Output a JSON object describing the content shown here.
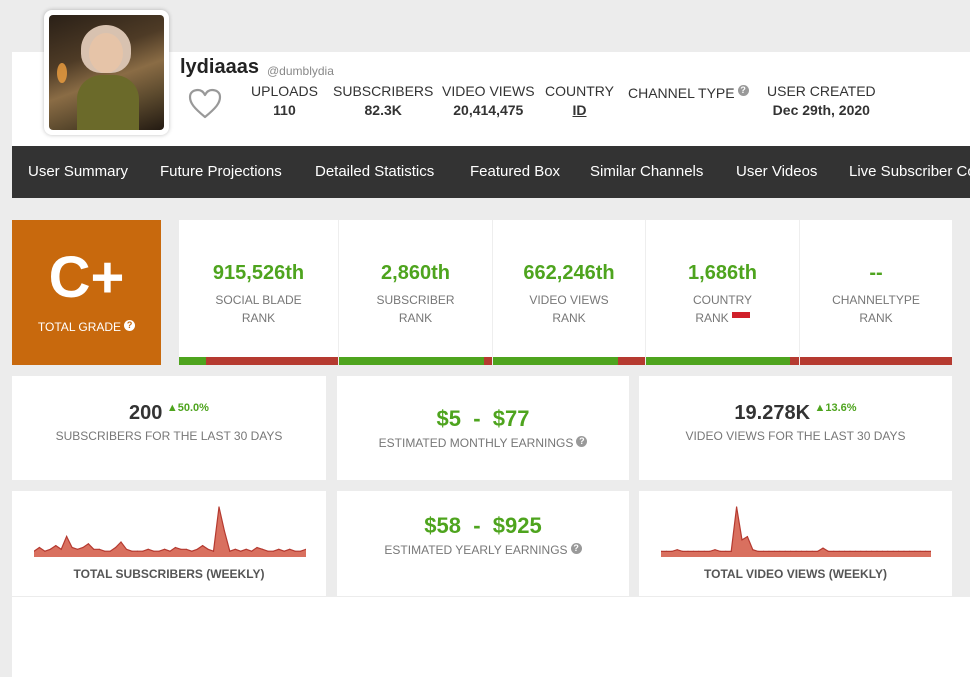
{
  "channel": {
    "name": "lydiaaas",
    "handle": "@dumblydia",
    "avatar_icon": "profile-photo"
  },
  "header_stats": [
    {
      "label": "UPLOADS",
      "value": "110"
    },
    {
      "label": "SUBSCRIBERS",
      "value": "82.3K"
    },
    {
      "label": "VIDEO VIEWS",
      "value": "20,414,475"
    },
    {
      "label": "COUNTRY",
      "value": "ID"
    },
    {
      "label": "CHANNEL TYPE",
      "value": ""
    },
    {
      "label": "USER CREATED",
      "value": "Dec 29th, 2020"
    }
  ],
  "nav": [
    "User Summary",
    "Future Projections",
    "Detailed Statistics",
    "Featured Box",
    "Similar Channels",
    "User Videos",
    "Live Subscriber Co"
  ],
  "grade": {
    "value": "C+",
    "label": "TOTAL GRADE"
  },
  "ranks": [
    {
      "value": "915,526th",
      "line1": "SOCIAL BLADE",
      "line2": "RANK",
      "fill": 0.17
    },
    {
      "value": "2,860th",
      "line1": "SUBSCRIBER",
      "line2": "RANK",
      "fill": 0.95
    },
    {
      "value": "662,246th",
      "line1": "VIDEO VIEWS",
      "line2": "RANK",
      "fill": 0.82
    },
    {
      "value": "1,686th",
      "line1": "COUNTRY",
      "line2": "RANK",
      "fill": 0.94
    },
    {
      "value": "--",
      "line1": "CHANNELTYPE",
      "line2": "RANK",
      "fill": 0.0
    }
  ],
  "summary": {
    "subs30": {
      "value": "200",
      "delta": "50.0%",
      "label": "SUBSCRIBERS FOR THE LAST 30 DAYS"
    },
    "monthly": {
      "low": "$5",
      "sep": "-",
      "high": "$77",
      "label": "ESTIMATED MONTHLY EARNINGS"
    },
    "views30": {
      "value": "19.278K",
      "delta": "13.6%",
      "label": "VIDEO VIEWS FOR THE LAST 30 DAYS"
    },
    "yearly": {
      "low": "$58",
      "sep": "-",
      "high": "$925",
      "label": "ESTIMATED YEARLY EARNINGS"
    },
    "subs_weekly_label": "TOTAL SUBSCRIBERS (WEEKLY)",
    "views_weekly_label": "TOTAL VIDEO VIEWS (WEEKLY)"
  },
  "colors": {
    "green": "#4ea41e",
    "red": "#b53a30",
    "grade_orange": "#c8690d",
    "nav_bg": "#333333",
    "spark_fill": "#d9705f",
    "spark_line": "#b53a30"
  },
  "chart_data": [
    {
      "type": "area",
      "title": "TOTAL SUBSCRIBERS (WEEKLY)",
      "values": [
        1,
        3,
        1,
        2,
        4,
        2,
        9,
        3,
        2,
        3,
        5,
        2,
        2,
        1,
        1,
        3,
        6,
        2,
        1,
        1,
        1,
        2,
        1,
        1,
        2,
        1,
        3,
        2,
        2,
        1,
        2,
        4,
        2,
        1,
        25,
        12,
        1,
        2,
        1,
        2,
        1,
        3,
        2,
        1,
        1,
        2,
        1,
        2,
        1,
        1,
        2
      ]
    },
    {
      "type": "area",
      "title": "TOTAL VIDEO VIEWS (WEEKLY)",
      "values": [
        1,
        1,
        1,
        2,
        1,
        1,
        1,
        1,
        1,
        1,
        2,
        1,
        1,
        1,
        28,
        8,
        10,
        2,
        1,
        1,
        1,
        1,
        1,
        1,
        1,
        1,
        1,
        1,
        1,
        1,
        3,
        1,
        1,
        1,
        1,
        1,
        1,
        1,
        1,
        1,
        1,
        1,
        1,
        1,
        1,
        1,
        1,
        1,
        1,
        1,
        1
      ]
    }
  ]
}
